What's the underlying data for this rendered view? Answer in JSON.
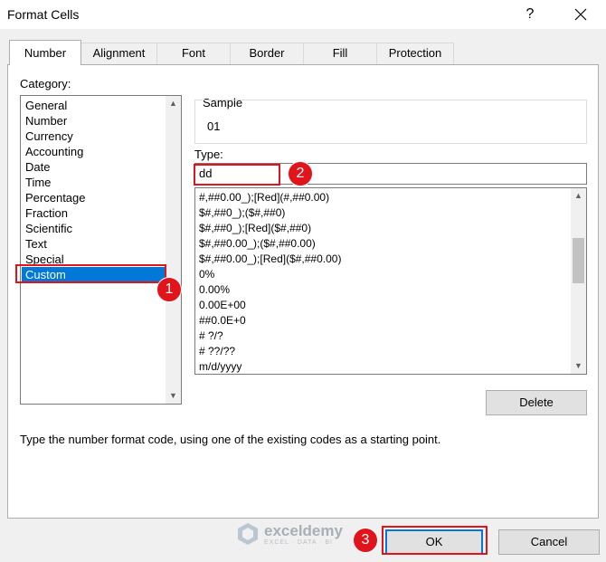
{
  "dialog": {
    "title": "Format Cells",
    "help": "?"
  },
  "tabs": [
    {
      "label": "Number"
    },
    {
      "label": "Alignment"
    },
    {
      "label": "Font"
    },
    {
      "label": "Border"
    },
    {
      "label": "Fill"
    },
    {
      "label": "Protection"
    }
  ],
  "category": {
    "label": "Category:",
    "items": [
      "General",
      "Number",
      "Currency",
      "Accounting",
      "Date",
      "Time",
      "Percentage",
      "Fraction",
      "Scientific",
      "Text",
      "Special",
      "Custom"
    ],
    "selected": "Custom"
  },
  "sample": {
    "label": "Sample",
    "value": "01"
  },
  "type": {
    "label": "Type:",
    "value": "dd"
  },
  "format_list": [
    "#,##0.00_);[Red](#,##0.00)",
    "$#,##0_);($#,##0)",
    "$#,##0_);[Red]($#,##0)",
    "$#,##0.00_);($#,##0.00)",
    "$#,##0.00_);[Red]($#,##0.00)",
    "0%",
    "0.00%",
    "0.00E+00",
    "##0.0E+0",
    "# ?/?",
    "# ??/??",
    "m/d/yyyy"
  ],
  "buttons": {
    "delete": "Delete",
    "ok": "OK",
    "cancel": "Cancel"
  },
  "hint": "Type the number format code, using one of the existing codes as a starting point.",
  "annotations": [
    "1",
    "2",
    "3"
  ],
  "watermark": {
    "name": "exceldemy",
    "tagline": "EXCEL · DATA · BI"
  },
  "colors": {
    "selection": "#0078d7",
    "highlight": "#e2141b"
  }
}
